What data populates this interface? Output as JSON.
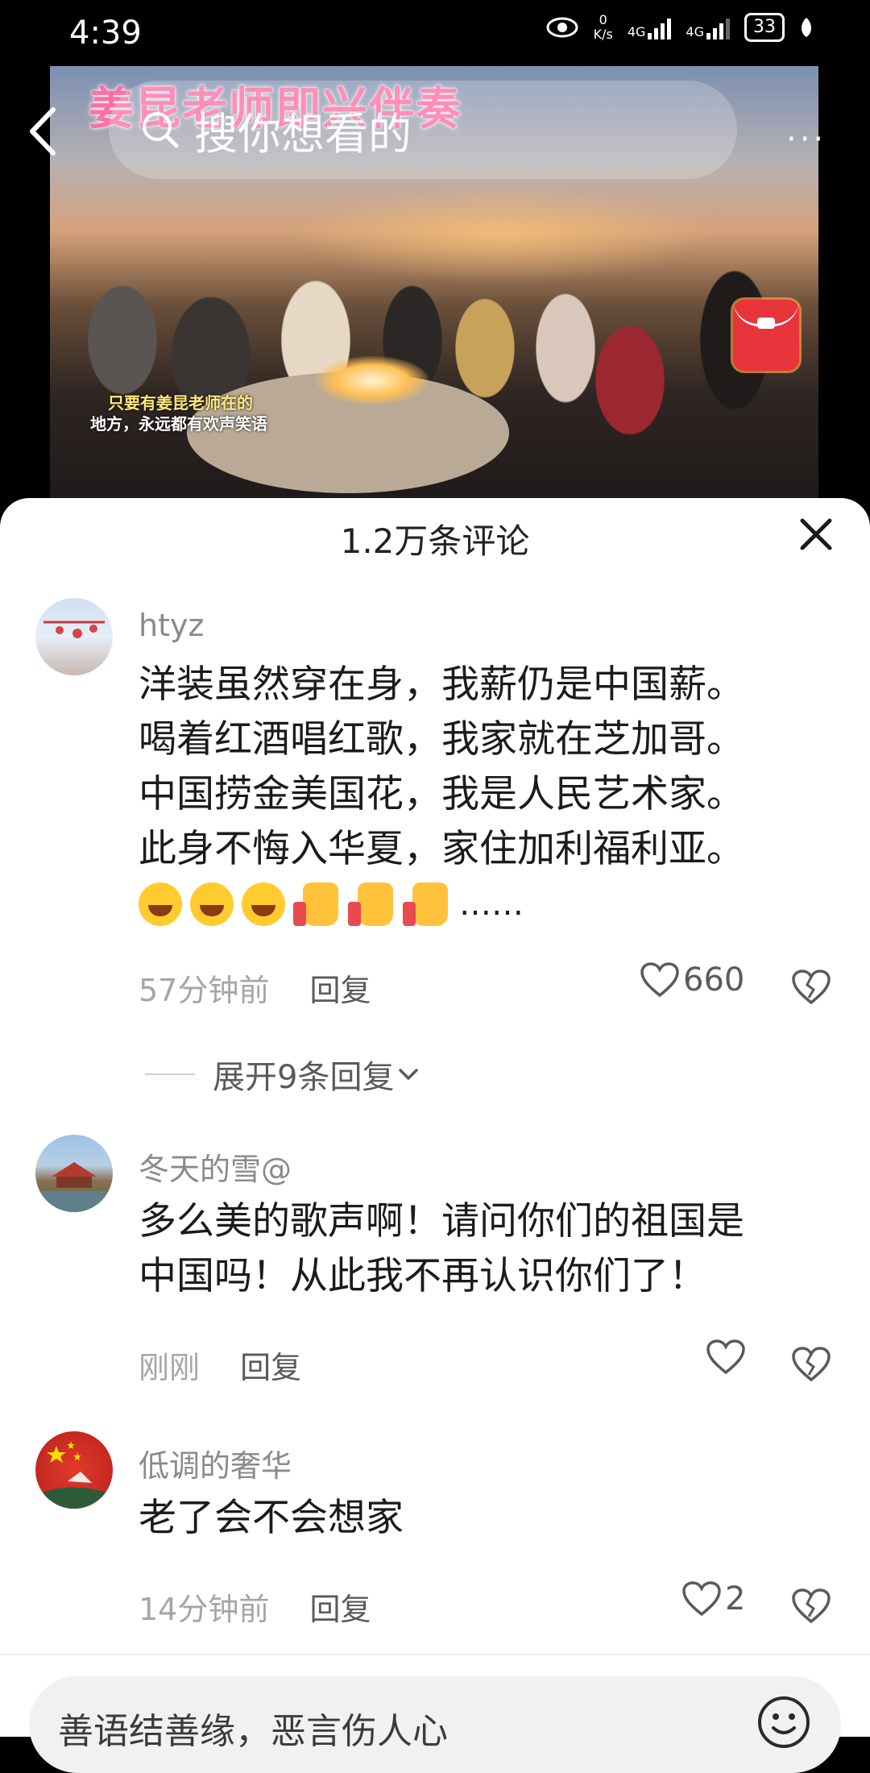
{
  "status_bar": {
    "time": "4:39",
    "net_speed_top": "0",
    "net_speed_unit": "K/s",
    "sim1": "4G",
    "sim2": "4G",
    "battery": "33"
  },
  "video": {
    "title_overlay": "姜昆老师即兴伴奏",
    "search_placeholder": "搜你想看的",
    "caption_line1": "只要有姜昆老师在的",
    "caption_line2": "地方，永远都有欢声笑语"
  },
  "sheet": {
    "title": "1.2万条评论"
  },
  "comments": [
    {
      "username": "htyz",
      "lines": [
        "洋装虽然穿在身，我薪仍是中国薪。",
        "喝着红酒唱红歌，我家就在芝加哥。",
        "中国捞金美国花，我是人民艺术家。",
        "此身不悔入华夏，家住加利福利亚。"
      ],
      "emoji_tail": "……",
      "time": "57分钟前",
      "reply_label": "回复",
      "likes": "660"
    },
    {
      "username": "冬天的雪@",
      "lines": [
        "多么美的歌声啊！请问你们的祖国是",
        "中国吗！从此我不再认识你们了！"
      ],
      "time": "刚刚",
      "reply_label": "回复",
      "likes": ""
    },
    {
      "username": "低调的奢华",
      "lines": [
        "老了会不会想家"
      ],
      "time": "14分钟前",
      "reply_label": "回复",
      "likes": "2"
    }
  ],
  "expand_replies": "展开9条回复",
  "input": {
    "placeholder": "善语结善缘，恶言伤人心"
  }
}
